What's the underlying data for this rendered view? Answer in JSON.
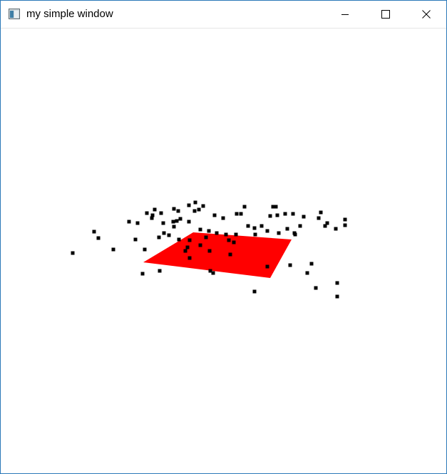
{
  "window": {
    "title": "my simple window"
  },
  "icons": {
    "app": "app-window-icon",
    "minimize": "minimize-icon",
    "maximize": "maximize-icon",
    "close": "close-icon"
  },
  "colors": {
    "frame_border": "#2b79b8",
    "plane": "#ff0000",
    "points": "#000000",
    "background": "#ffffff"
  }
}
